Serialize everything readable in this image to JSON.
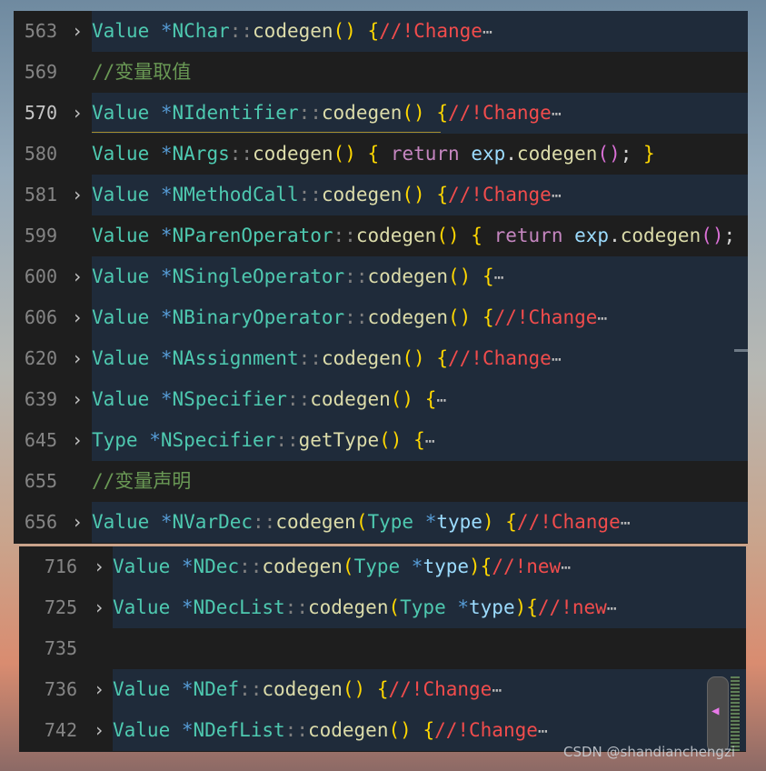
{
  "editor": {
    "top_lines": [
      {
        "number": "563",
        "fold": "›",
        "folded": true,
        "active": false,
        "tokens": [
          [
            "t-type",
            "Value"
          ],
          [
            "t-op",
            " *"
          ],
          [
            "t-type",
            "NChar"
          ],
          [
            "t-p",
            "::"
          ],
          [
            "t-fn",
            "codegen"
          ],
          [
            "t-br1",
            "()"
          ],
          [
            "t-semi",
            " "
          ],
          [
            "t-br1",
            "{"
          ],
          [
            "t-red",
            "//!Change"
          ],
          [
            "t-el",
            "⋯"
          ]
        ]
      },
      {
        "number": "569",
        "fold": "",
        "folded": false,
        "active": false,
        "tokens": [
          [
            "t-cm",
            "//变量取值"
          ]
        ]
      },
      {
        "number": "570",
        "fold": "›",
        "folded": true,
        "active": true,
        "tokens": [
          [
            "t-type",
            "Value"
          ],
          [
            "t-op",
            " *"
          ],
          [
            "t-type",
            "NIdentifier"
          ],
          [
            "t-p",
            "::"
          ],
          [
            "t-fn",
            "codegen"
          ],
          [
            "t-br1",
            "()"
          ],
          [
            "t-semi",
            " "
          ],
          [
            "t-br1",
            "{"
          ],
          [
            "t-red",
            "//!Change"
          ],
          [
            "t-el",
            "⋯"
          ]
        ]
      },
      {
        "number": "580",
        "fold": "",
        "folded": false,
        "active": false,
        "tokens": [
          [
            "t-type",
            "Value"
          ],
          [
            "t-op",
            " *"
          ],
          [
            "t-type",
            "NArgs"
          ],
          [
            "t-p",
            "::"
          ],
          [
            "t-fn",
            "codegen"
          ],
          [
            "t-br1",
            "()"
          ],
          [
            "t-semi",
            " "
          ],
          [
            "t-br1",
            "{"
          ],
          [
            "t-semi",
            " "
          ],
          [
            "t-kw",
            "return"
          ],
          [
            "t-semi",
            " "
          ],
          [
            "t-var",
            "exp"
          ],
          [
            "t-semi",
            "."
          ],
          [
            "t-fn",
            "codegen"
          ],
          [
            "t-br2",
            "()"
          ],
          [
            "t-semi",
            "; "
          ],
          [
            "t-br1",
            "}"
          ]
        ]
      },
      {
        "number": "581",
        "fold": "›",
        "folded": true,
        "active": false,
        "tokens": [
          [
            "t-type",
            "Value"
          ],
          [
            "t-op",
            " *"
          ],
          [
            "t-type",
            "NMethodCall"
          ],
          [
            "t-p",
            "::"
          ],
          [
            "t-fn",
            "codegen"
          ],
          [
            "t-br1",
            "()"
          ],
          [
            "t-semi",
            " "
          ],
          [
            "t-br1",
            "{"
          ],
          [
            "t-red",
            "//!Change"
          ],
          [
            "t-el",
            "⋯"
          ]
        ]
      },
      {
        "number": "599",
        "fold": "",
        "folded": false,
        "active": false,
        "tokens": [
          [
            "t-type",
            "Value"
          ],
          [
            "t-op",
            " *"
          ],
          [
            "t-type",
            "NParenOperator"
          ],
          [
            "t-p",
            "::"
          ],
          [
            "t-fn",
            "codegen"
          ],
          [
            "t-br1",
            "()"
          ],
          [
            "t-semi",
            " "
          ],
          [
            "t-br1",
            "{"
          ],
          [
            "t-semi",
            " "
          ],
          [
            "t-kw",
            "return"
          ],
          [
            "t-semi",
            " "
          ],
          [
            "t-var",
            "exp"
          ],
          [
            "t-semi",
            "."
          ],
          [
            "t-fn",
            "codegen"
          ],
          [
            "t-br2",
            "()"
          ],
          [
            "t-semi",
            "; "
          ],
          [
            "t-br1",
            "}"
          ]
        ]
      },
      {
        "number": "600",
        "fold": "›",
        "folded": true,
        "active": false,
        "tokens": [
          [
            "t-type",
            "Value"
          ],
          [
            "t-op",
            " *"
          ],
          [
            "t-type",
            "NSingleOperator"
          ],
          [
            "t-p",
            "::"
          ],
          [
            "t-fn",
            "codegen"
          ],
          [
            "t-br1",
            "()"
          ],
          [
            "t-semi",
            " "
          ],
          [
            "t-br1",
            "{"
          ],
          [
            "t-el",
            "⋯"
          ]
        ]
      },
      {
        "number": "606",
        "fold": "›",
        "folded": true,
        "active": false,
        "tokens": [
          [
            "t-type",
            "Value"
          ],
          [
            "t-op",
            " *"
          ],
          [
            "t-type",
            "NBinaryOperator"
          ],
          [
            "t-p",
            "::"
          ],
          [
            "t-fn",
            "codegen"
          ],
          [
            "t-br1",
            "()"
          ],
          [
            "t-semi",
            " "
          ],
          [
            "t-br1",
            "{"
          ],
          [
            "t-red",
            "//!Change"
          ],
          [
            "t-el",
            "⋯"
          ]
        ]
      },
      {
        "number": "620",
        "fold": "›",
        "folded": true,
        "active": false,
        "tokens": [
          [
            "t-type",
            "Value"
          ],
          [
            "t-op",
            " *"
          ],
          [
            "t-type",
            "NAssignment"
          ],
          [
            "t-p",
            "::"
          ],
          [
            "t-fn",
            "codegen"
          ],
          [
            "t-br1",
            "()"
          ],
          [
            "t-semi",
            " "
          ],
          [
            "t-br1",
            "{"
          ],
          [
            "t-red",
            "//!Change"
          ],
          [
            "t-el",
            "⋯"
          ]
        ]
      },
      {
        "number": "639",
        "fold": "›",
        "folded": true,
        "active": false,
        "tokens": [
          [
            "t-type",
            "Value"
          ],
          [
            "t-op",
            " *"
          ],
          [
            "t-type",
            "NSpecifier"
          ],
          [
            "t-p",
            "::"
          ],
          [
            "t-fn",
            "codegen"
          ],
          [
            "t-br1",
            "()"
          ],
          [
            "t-semi",
            " "
          ],
          [
            "t-br1",
            "{"
          ],
          [
            "t-el",
            "⋯"
          ]
        ]
      },
      {
        "number": "645",
        "fold": "›",
        "folded": true,
        "active": false,
        "tokens": [
          [
            "t-type",
            "Type"
          ],
          [
            "t-op",
            " *"
          ],
          [
            "t-type",
            "NSpecifier"
          ],
          [
            "t-p",
            "::"
          ],
          [
            "t-fn",
            "getType"
          ],
          [
            "t-br1",
            "()"
          ],
          [
            "t-semi",
            " "
          ],
          [
            "t-br1",
            "{"
          ],
          [
            "t-el",
            "⋯"
          ]
        ]
      },
      {
        "number": "655",
        "fold": "",
        "folded": false,
        "active": false,
        "tokens": [
          [
            "t-cm",
            "//变量声明"
          ]
        ]
      },
      {
        "number": "656",
        "fold": "›",
        "folded": true,
        "active": false,
        "tokens": [
          [
            "t-type",
            "Value"
          ],
          [
            "t-op",
            " *"
          ],
          [
            "t-type",
            "NVarDec"
          ],
          [
            "t-p",
            "::"
          ],
          [
            "t-fn",
            "codegen"
          ],
          [
            "t-br1",
            "("
          ],
          [
            "t-type",
            "Type"
          ],
          [
            "t-op",
            " *"
          ],
          [
            "t-var",
            "type"
          ],
          [
            "t-br1",
            ")"
          ],
          [
            "t-semi",
            " "
          ],
          [
            "t-br1",
            "{"
          ],
          [
            "t-red",
            "//!Change"
          ],
          [
            "t-el",
            "⋯"
          ]
        ]
      }
    ],
    "bottom_lines": [
      {
        "number": "716",
        "fold": "›",
        "folded": true,
        "active": false,
        "tokens": [
          [
            "t-type",
            "Value"
          ],
          [
            "t-op",
            " *"
          ],
          [
            "t-type",
            "NDec"
          ],
          [
            "t-p",
            "::"
          ],
          [
            "t-fn",
            "codegen"
          ],
          [
            "t-br1",
            "("
          ],
          [
            "t-type",
            "Type"
          ],
          [
            "t-op",
            " *"
          ],
          [
            "t-var",
            "type"
          ],
          [
            "t-br1",
            ")"
          ],
          [
            "t-br1",
            "{"
          ],
          [
            "t-red",
            "//!new"
          ],
          [
            "t-el",
            "⋯"
          ]
        ]
      },
      {
        "number": "725",
        "fold": "›",
        "folded": true,
        "active": false,
        "tokens": [
          [
            "t-type",
            "Value"
          ],
          [
            "t-op",
            " *"
          ],
          [
            "t-type",
            "NDecList"
          ],
          [
            "t-p",
            "::"
          ],
          [
            "t-fn",
            "codegen"
          ],
          [
            "t-br1",
            "("
          ],
          [
            "t-type",
            "Type"
          ],
          [
            "t-op",
            " *"
          ],
          [
            "t-var",
            "type"
          ],
          [
            "t-br1",
            ")"
          ],
          [
            "t-br1",
            "{"
          ],
          [
            "t-red",
            "//!new"
          ],
          [
            "t-el",
            "⋯"
          ]
        ]
      },
      {
        "number": "735",
        "fold": "",
        "folded": false,
        "active": false,
        "tokens": []
      },
      {
        "number": "736",
        "fold": "›",
        "folded": true,
        "active": false,
        "tokens": [
          [
            "t-type",
            "Value"
          ],
          [
            "t-op",
            " *"
          ],
          [
            "t-type",
            "NDef"
          ],
          [
            "t-p",
            "::"
          ],
          [
            "t-fn",
            "codegen"
          ],
          [
            "t-br1",
            "()"
          ],
          [
            "t-semi",
            " "
          ],
          [
            "t-br1",
            "{"
          ],
          [
            "t-red",
            "//!Change"
          ],
          [
            "t-el",
            "⋯"
          ]
        ]
      },
      {
        "number": "742",
        "fold": "›",
        "folded": true,
        "active": false,
        "tokens": [
          [
            "t-type",
            "Value"
          ],
          [
            "t-op",
            " *"
          ],
          [
            "t-type",
            "NDefList"
          ],
          [
            "t-p",
            "::"
          ],
          [
            "t-fn",
            "codegen"
          ],
          [
            "t-br1",
            "()"
          ],
          [
            "t-semi",
            " "
          ],
          [
            "t-br1",
            "{"
          ],
          [
            "t-red",
            "//!Change"
          ],
          [
            "t-el",
            "⋯"
          ]
        ]
      }
    ]
  },
  "icons": {
    "fold": "chevron-right-icon",
    "minimap": "minimap-slider-icon"
  },
  "colors": {
    "background": "#1e1e1e",
    "folded_line": "#1f2b3a",
    "line_number": "#858585",
    "type": "#4ec9b0",
    "comment": "#6a9955",
    "change_marker": "#f14c4c",
    "keyword": "#c586c0",
    "bracket": "#ffd700"
  },
  "watermark": "CSDN @shandianchengzi",
  "minimap_glyph": "◀"
}
